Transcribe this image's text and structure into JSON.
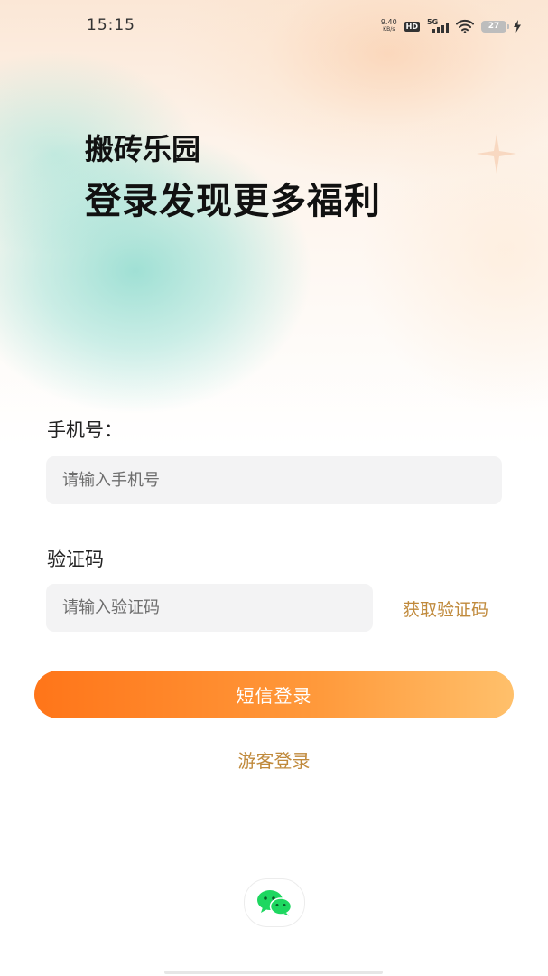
{
  "status_bar": {
    "time": "15:15",
    "net_speed_value": "9.40",
    "net_speed_unit": "KB/s",
    "hd_label": "HD",
    "network_type": "5G",
    "battery_level": "27"
  },
  "header": {
    "app_name": "搬砖乐园",
    "tagline": "登录发现更多福利"
  },
  "form": {
    "phone_label": "手机号：",
    "phone_placeholder": "请输入手机号",
    "code_label": "验证码",
    "code_placeholder": "请输入验证码",
    "get_code_label": "获取验证码"
  },
  "actions": {
    "sms_login_label": "短信登录",
    "guest_login_label": "游客登录"
  },
  "icons": {
    "wechat": "wechat-icon",
    "wifi": "wifi-icon",
    "charging": "charging-icon"
  },
  "colors": {
    "accent_gold": "#c08a3c",
    "button_gradient_start": "#ff7519",
    "button_gradient_end": "#ffc06b",
    "wechat_green": "#1ed760"
  }
}
